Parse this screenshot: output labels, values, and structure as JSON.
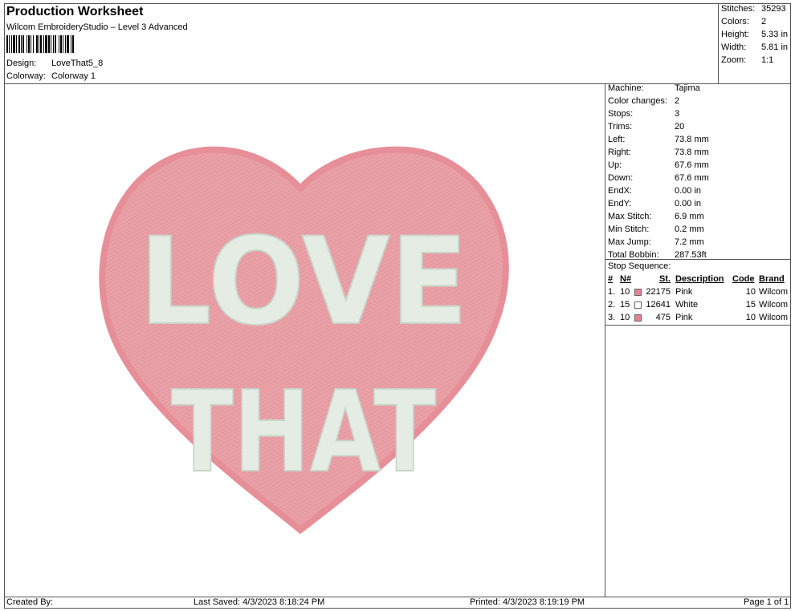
{
  "header": {
    "title": "Production Worksheet",
    "software": "Wilcom EmbroideryStudio – Level 3 Advanced",
    "design_label": "Design:",
    "design_value": "LoveThat5_8",
    "colorway_label": "Colorway:",
    "colorway_value": "Colorway 1"
  },
  "stats": [
    {
      "label": "Stitches:",
      "value": "35293"
    },
    {
      "label": "Colors:",
      "value": "2"
    },
    {
      "label": "Height:",
      "value": "5.33 in"
    },
    {
      "label": "Width:",
      "value": "5.81 in"
    },
    {
      "label": "Zoom:",
      "value": "1:1"
    }
  ],
  "properties": [
    {
      "label": "Machine:",
      "value": "Tajima"
    },
    {
      "label": "Color changes:",
      "value": "2"
    },
    {
      "label": "Stops:",
      "value": "3"
    },
    {
      "label": "Trims:",
      "value": "20"
    },
    {
      "label": "Left:",
      "value": "73.8 mm"
    },
    {
      "label": "Right:",
      "value": "73.8 mm"
    },
    {
      "label": "Up:",
      "value": "67.6 mm"
    },
    {
      "label": "Down:",
      "value": "67.6 mm"
    },
    {
      "label": "EndX:",
      "value": "0.00 in"
    },
    {
      "label": "EndY:",
      "value": "0.00 in"
    },
    {
      "label": "Max Stitch:",
      "value": "6.9 mm"
    },
    {
      "label": "Min Stitch:",
      "value": "0.2 mm"
    },
    {
      "label": "Max Jump:",
      "value": "7.2 mm"
    },
    {
      "label": "Total Bobbin:",
      "value": "287.53ft"
    }
  ],
  "stop_sequence": {
    "title": "Stop Sequence:",
    "headers": {
      "num": "#",
      "needle": "N#",
      "stitches": "St.",
      "description": "Description",
      "code": "Code",
      "brand": "Brand"
    },
    "rows": [
      {
        "num": "1.",
        "needle": "10",
        "color": "#e8818f",
        "stitches": "22175",
        "description": "Pink",
        "code": "10",
        "brand": "Wilcom"
      },
      {
        "num": "2.",
        "needle": "15",
        "color": "#ffffff",
        "stitches": "12641",
        "description": "White",
        "code": "15",
        "brand": "Wilcom"
      },
      {
        "num": "3.",
        "needle": "10",
        "color": "#e8818f",
        "stitches": "475",
        "description": "Pink",
        "code": "10",
        "brand": "Wilcom"
      }
    ]
  },
  "footer": {
    "created_by": "Created By:",
    "last_saved": "Last Saved: 4/3/2023 8:18:24 PM",
    "printed": "Printed: 4/3/2023 8:19:19 PM",
    "page": "Page 1 of 1"
  },
  "design": {
    "line1": "LOVE",
    "line2": "THAT",
    "heart_fill": "#e9a0a6",
    "heart_edge": "#e68f98",
    "letter_fill": "#e4ece3"
  }
}
